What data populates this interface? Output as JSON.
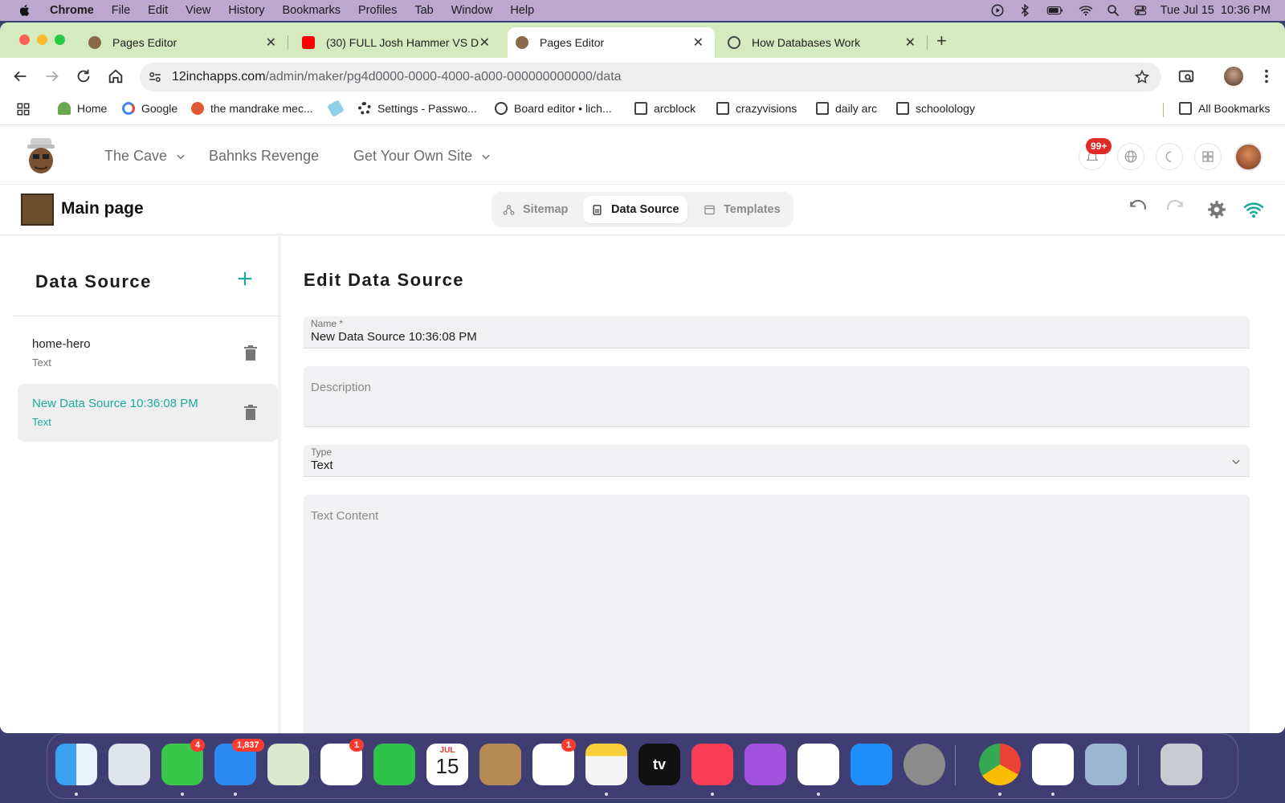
{
  "menubar": {
    "app": "Chrome",
    "items": [
      "File",
      "Edit",
      "View",
      "History",
      "Bookmarks",
      "Profiles",
      "Tab",
      "Window",
      "Help"
    ],
    "clock": "Tue Jul 15  10:36 PM"
  },
  "tabs": [
    {
      "title": "Pages Editor",
      "close": "✕"
    },
    {
      "title": "(30) FULL Josh Hammer VS D",
      "close": "✕"
    },
    {
      "title": "Pages Editor",
      "close": "✕"
    },
    {
      "title": "How Databases Work",
      "close": "✕"
    }
  ],
  "new_tab": "+",
  "address": {
    "domain": "12inchapps.com",
    "path": "/admin/maker/pg4d0000-0000-4000-a000-000000000000/data"
  },
  "bookmarks": {
    "items": [
      "Home",
      "Google",
      "the mandrake mec...",
      "Settings - Passwo...",
      "Board editor • lich...",
      "arcblock",
      "crazyvisions",
      "daily arc",
      "schoolology"
    ],
    "all": "All Bookmarks"
  },
  "header": {
    "nav": [
      "The Cave",
      "Bahnks Revenge",
      "Get Your Own Site"
    ],
    "notif_badge": "99+"
  },
  "editor": {
    "page_title": "Main page",
    "tabs": [
      "Sitemap",
      "Data Source",
      "Templates"
    ]
  },
  "sidebar": {
    "title": "Data Source",
    "items": [
      {
        "name": "home-hero",
        "type": "Text"
      },
      {
        "name": "New Data Source 10:36:08 PM",
        "type": "Text"
      }
    ]
  },
  "form": {
    "title": "Edit Data Source",
    "name_label": "Name *",
    "name_value": "New Data Source 10:36:08 PM",
    "description_placeholder": "Description",
    "type_label": "Type",
    "type_value": "Text",
    "content_placeholder": "Text Content"
  },
  "dock": {
    "badges": {
      "messages": "4",
      "mail": "1,837",
      "photos": "1",
      "reminders": "1"
    },
    "calendar_month": "JUL",
    "calendar_day": "15",
    "tv_label": "tv"
  },
  "colors": {
    "accent": "#1aab9c",
    "tabstrip": "#d4ebbf",
    "menubar": "#bda7cf",
    "badge": "#e02a2a"
  }
}
